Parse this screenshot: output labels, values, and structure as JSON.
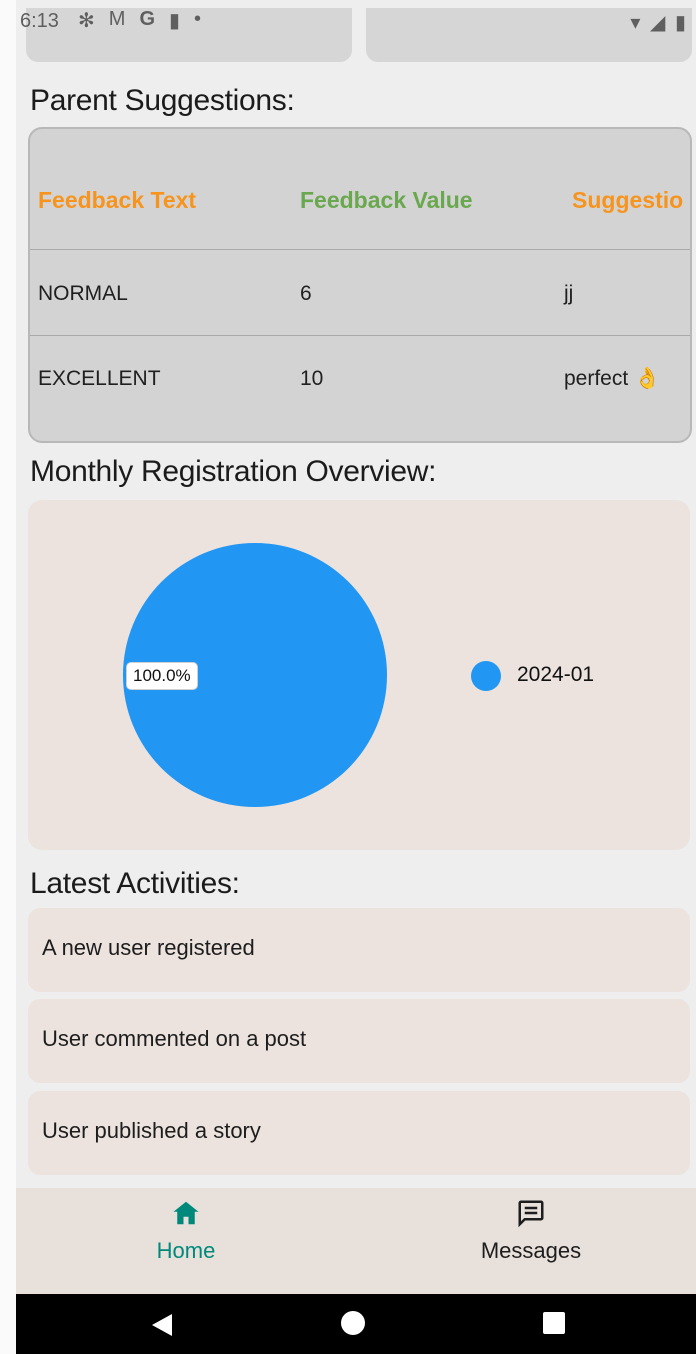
{
  "status_bar": {
    "time": "6:13",
    "left_icons": [
      "gear-icon",
      "gmail-icon",
      "google-icon",
      "sd-card-icon",
      "dot-icon"
    ],
    "right_icons": [
      "wifi-icon",
      "signal-icon",
      "battery-icon"
    ]
  },
  "parent_suggestions": {
    "title": "Parent Suggestions:",
    "columns": [
      "Feedback Text",
      "Feedback Value",
      "Suggestio"
    ],
    "column_colors": [
      "#f7941d",
      "#6aa84f",
      "#f7941d"
    ],
    "rows": [
      [
        "NORMAL",
        "6",
        "jj"
      ],
      [
        "EXCELLENT",
        "10",
        "perfect 👌"
      ]
    ]
  },
  "monthly_registration": {
    "title": "Monthly Registration Overview:"
  },
  "chart_data": {
    "type": "pie",
    "slices": [
      {
        "label": "2024-01",
        "value": 100.0,
        "color": "#2196f3",
        "display": "100.0%"
      }
    ],
    "legend_placement": "right"
  },
  "latest_activities": {
    "title": "Latest Activities:",
    "items": [
      "A new user registered",
      "User commented on a post",
      "User published a story"
    ]
  },
  "bottom_nav": {
    "items": [
      {
        "label": "Home",
        "icon": "home-icon",
        "active": true,
        "color": "#00897b"
      },
      {
        "label": "Messages",
        "icon": "message-icon",
        "active": false,
        "color": "#1d1d1d"
      }
    ]
  },
  "system_nav": {
    "icons": [
      "back-icon",
      "home-circle-icon",
      "recents-icon"
    ]
  }
}
